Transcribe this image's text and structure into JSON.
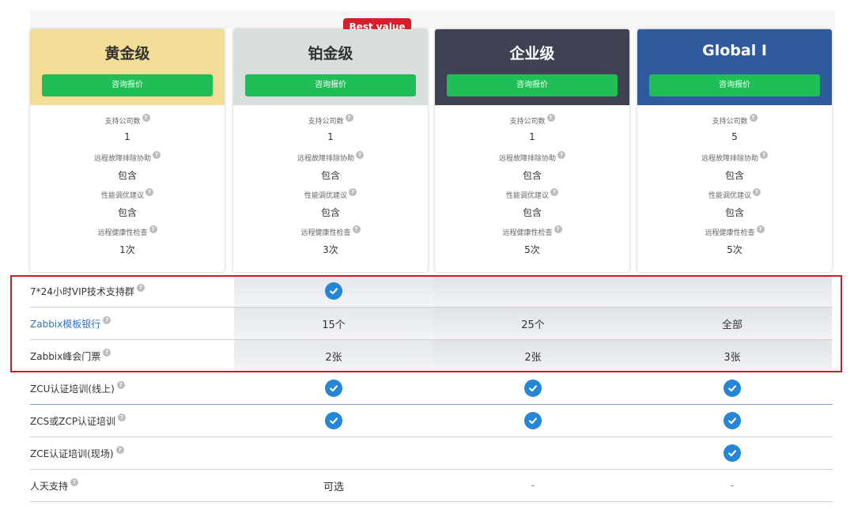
{
  "badge": "Best value",
  "plans": [
    {
      "name": "黄金级",
      "button": "咨询报价",
      "head_bg": "#f4de97",
      "name_color": "#333333",
      "features": [
        {
          "label": "支持公司数",
          "value": "1"
        },
        {
          "label": "远程故障排除协助",
          "value": "包含"
        },
        {
          "label": "性能调优建议",
          "value": "包含"
        },
        {
          "label": "远程健康性检查",
          "value": "1次"
        }
      ]
    },
    {
      "name": "铂金级",
      "button": "咨询报价",
      "head_bg": "#d9dfdf",
      "name_color": "#333333",
      "features": [
        {
          "label": "支持公司数",
          "value": "1"
        },
        {
          "label": "远程故障排除协助",
          "value": "包含"
        },
        {
          "label": "性能调优建议",
          "value": "包含"
        },
        {
          "label": "远程健康性检查",
          "value": "3次"
        }
      ]
    },
    {
      "name": "企业级",
      "button": "咨询报价",
      "head_bg": "#3f4253",
      "name_color": "#ffffff",
      "features": [
        {
          "label": "支持公司数",
          "value": "1"
        },
        {
          "label": "远程故障排除协助",
          "value": "包含"
        },
        {
          "label": "性能调优建议",
          "value": "包含"
        },
        {
          "label": "远程健康性检查",
          "value": "5次"
        }
      ]
    },
    {
      "name": "Global I",
      "button": "咨询报价",
      "head_bg": "#2f5a9d",
      "name_color": "#ffffff",
      "features": [
        {
          "label": "支持公司数",
          "value": "5"
        },
        {
          "label": "远程故障排除协助",
          "value": "包含"
        },
        {
          "label": "性能调优建议",
          "value": "包含"
        },
        {
          "label": "远程健康性检查",
          "value": "5次"
        }
      ]
    }
  ],
  "rows": [
    {
      "label": "7*24小时VIP技术支持群",
      "cells": [
        "check",
        "",
        ""
      ]
    },
    {
      "label": "Zabbix模板银行",
      "cells": [
        "15个",
        "25个",
        "全部"
      ]
    },
    {
      "label": "Zabbix峰会门票",
      "cells": [
        "2张",
        "2张",
        "3张"
      ]
    },
    {
      "label": "ZCU认证培训(线上)",
      "cells": [
        "check",
        "check",
        "check"
      ]
    },
    {
      "label": "ZCS或ZCP认证培训",
      "cells": [
        "check",
        "check",
        "check"
      ]
    },
    {
      "label": "ZCE认证培训(现场)",
      "cells": [
        "",
        "",
        "check"
      ]
    },
    {
      "label": "人天支持",
      "cells": [
        "可选",
        "-",
        "-"
      ]
    }
  ],
  "colors": {
    "quote_button": "#20be57",
    "badge": "#d51f2a",
    "check": "#2586d6",
    "highlight_border": "#c81e26",
    "link": "#2f72c4"
  },
  "icons": {
    "help": "question-circle-icon",
    "check": "check-circle-icon"
  }
}
